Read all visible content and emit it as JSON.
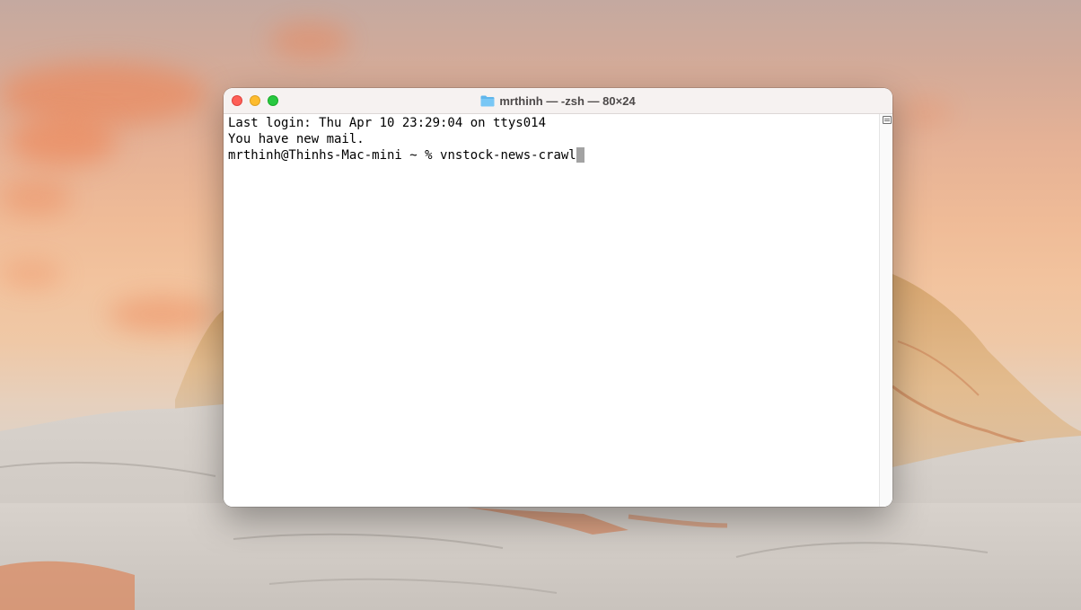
{
  "window": {
    "title": "mrthinh — -zsh — 80×24",
    "title_icon": "folder-icon",
    "controls": {
      "close": "close-button",
      "minimize": "minimize-button",
      "zoom": "zoom-button"
    }
  },
  "terminal": {
    "lines": [
      "Last login: Thu Apr 10 23:29:04 on ttys014",
      "You have new mail."
    ],
    "prompt": "mrthinh@Thinhs-Mac-mini ~ % ",
    "command": "vnstock-news-crawl",
    "cursor_icon": "block-cursor"
  },
  "scrollbar": {
    "button_icon": "scroll-menu-icon"
  },
  "colors": {
    "close": "#fe5f57",
    "minimize": "#febc2e",
    "zoom": "#28c840",
    "cursor": "#a3a3a3"
  }
}
